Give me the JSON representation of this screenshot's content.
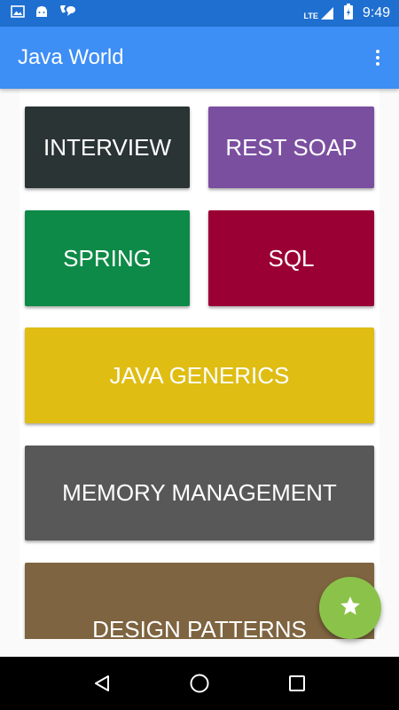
{
  "status_bar": {
    "time": "9:49",
    "network": "LTE",
    "icons": [
      "image-icon",
      "android-icon",
      "voicemail-chat-icon",
      "lte-signal-icon",
      "battery-icon"
    ]
  },
  "app_bar": {
    "title": "Java World",
    "overflow_icon": "more-vert-icon"
  },
  "tiles": [
    {
      "label": "INTERVIEW",
      "color": "#2b3434"
    },
    {
      "label": "REST SOAP",
      "color": "#7b4fa0"
    },
    {
      "label": "SPRING",
      "color": "#0d8a47"
    },
    {
      "label": "SQL",
      "color": "#9b0035"
    },
    {
      "label": "JAVA GENERICS",
      "color": "#dfbd13"
    },
    {
      "label": "MEMORY MANAGEMENT",
      "color": "#585858"
    },
    {
      "label": "DESIGN PATTERNS",
      "color": "#7e6440"
    }
  ],
  "fab": {
    "icon": "star-icon",
    "color": "#8bc34a"
  },
  "nav_bar": {
    "icons": [
      "back-icon",
      "home-icon",
      "recents-icon"
    ]
  }
}
